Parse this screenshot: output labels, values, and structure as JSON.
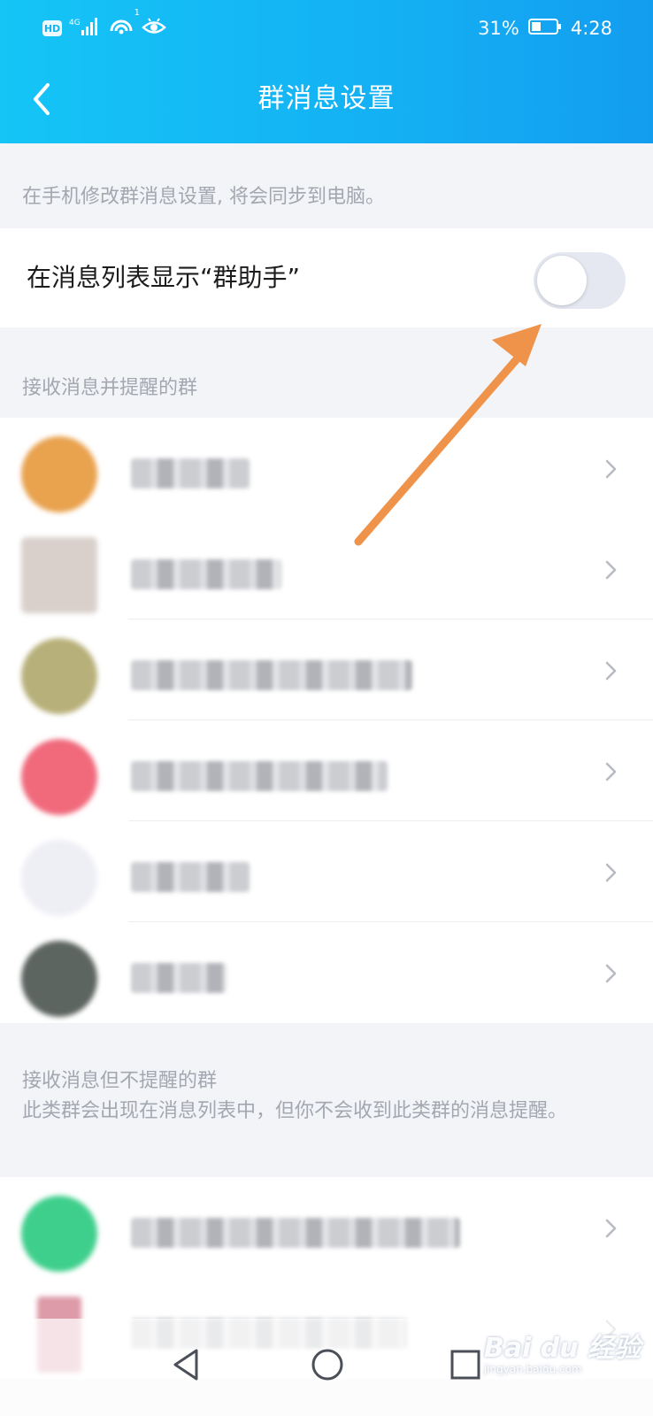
{
  "status_bar": {
    "hd_label": "HD",
    "network_label": "4G",
    "wifi_badge": "1",
    "battery_percent": "31%",
    "time": "4:28"
  },
  "header": {
    "title": "群消息设置"
  },
  "sync_note": "在手机修改群消息设置, 将会同步到电脑。",
  "assistant_toggle": {
    "label": "在消息列表显示“群助手”",
    "enabled": false
  },
  "section_notify": {
    "title": "接收消息并提醒的群",
    "groups": [
      {
        "avatar_color": "#e9a24e"
      },
      {
        "avatar_color": "#d9d0cb"
      },
      {
        "avatar_color": "#b8b07a"
      },
      {
        "avatar_color": "#f06a7c"
      },
      {
        "avatar_color": "#eeeef5"
      },
      {
        "avatar_color": "#5d6560"
      }
    ]
  },
  "section_silent": {
    "title": "接收消息但不提醒的群",
    "description": "此类群会出现在消息列表中，但你不会收到此类群的消息提醒。",
    "groups": [
      {
        "avatar_color": "#3fcf8c"
      },
      {
        "avatar_color": "#dd9aa8"
      }
    ]
  },
  "annotation": {
    "arrow_color": "#f0934a"
  },
  "watermark": {
    "brand": "Bai du 经验",
    "site": "jingyan.baidu.com"
  }
}
